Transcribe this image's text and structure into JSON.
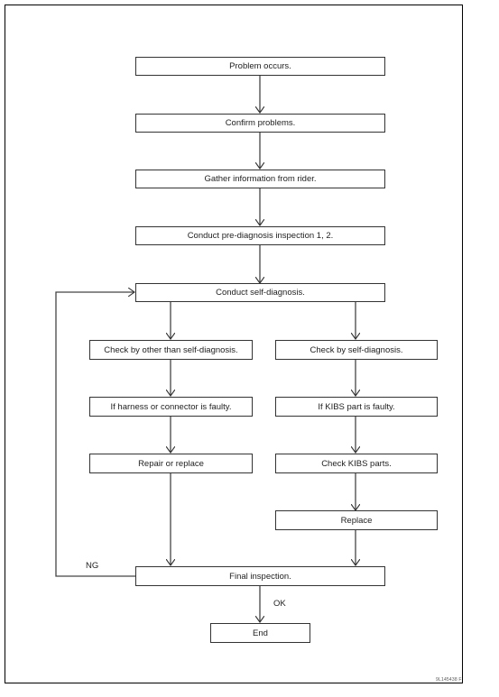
{
  "diagram": {
    "type": "flowchart",
    "nodes": [
      {
        "id": "problem_occurs",
        "label": "Problem occurs."
      },
      {
        "id": "confirm_problems",
        "label": "Confirm problems."
      },
      {
        "id": "gather_info",
        "label": "Gather information from rider."
      },
      {
        "id": "pre_diagnosis",
        "label": "Conduct pre-diagnosis inspection 1, 2."
      },
      {
        "id": "self_diagnosis",
        "label": "Conduct self-diagnosis."
      },
      {
        "id": "check_other",
        "label": "Check by other than self-diagnosis."
      },
      {
        "id": "check_self",
        "label": "Check by self-diagnosis."
      },
      {
        "id": "harness_faulty",
        "label": "If harness or connector is faulty."
      },
      {
        "id": "kibs_faulty",
        "label": "If KIBS part is faulty."
      },
      {
        "id": "repair_replace",
        "label": "Repair or replace"
      },
      {
        "id": "check_kibs",
        "label": "Check KIBS parts."
      },
      {
        "id": "replace",
        "label": "Replace"
      },
      {
        "id": "final_inspection",
        "label": "Final inspection."
      },
      {
        "id": "end",
        "label": "End"
      }
    ],
    "edges": [
      {
        "from": "problem_occurs",
        "to": "confirm_problems"
      },
      {
        "from": "confirm_problems",
        "to": "gather_info"
      },
      {
        "from": "gather_info",
        "to": "pre_diagnosis"
      },
      {
        "from": "pre_diagnosis",
        "to": "self_diagnosis"
      },
      {
        "from": "self_diagnosis",
        "to": "check_other"
      },
      {
        "from": "self_diagnosis",
        "to": "check_self"
      },
      {
        "from": "check_other",
        "to": "harness_faulty"
      },
      {
        "from": "harness_faulty",
        "to": "repair_replace"
      },
      {
        "from": "repair_replace",
        "to": "final_inspection"
      },
      {
        "from": "check_self",
        "to": "kibs_faulty"
      },
      {
        "from": "kibs_faulty",
        "to": "check_kibs"
      },
      {
        "from": "check_kibs",
        "to": "replace"
      },
      {
        "from": "replace",
        "to": "final_inspection"
      },
      {
        "from": "final_inspection",
        "to": "end",
        "label": "OK"
      },
      {
        "from": "final_inspection",
        "to": "self_diagnosis",
        "label": "NG"
      }
    ],
    "edge_labels": {
      "ok": "OK",
      "ng": "NG"
    },
    "figure_id": "9L145438  F"
  }
}
